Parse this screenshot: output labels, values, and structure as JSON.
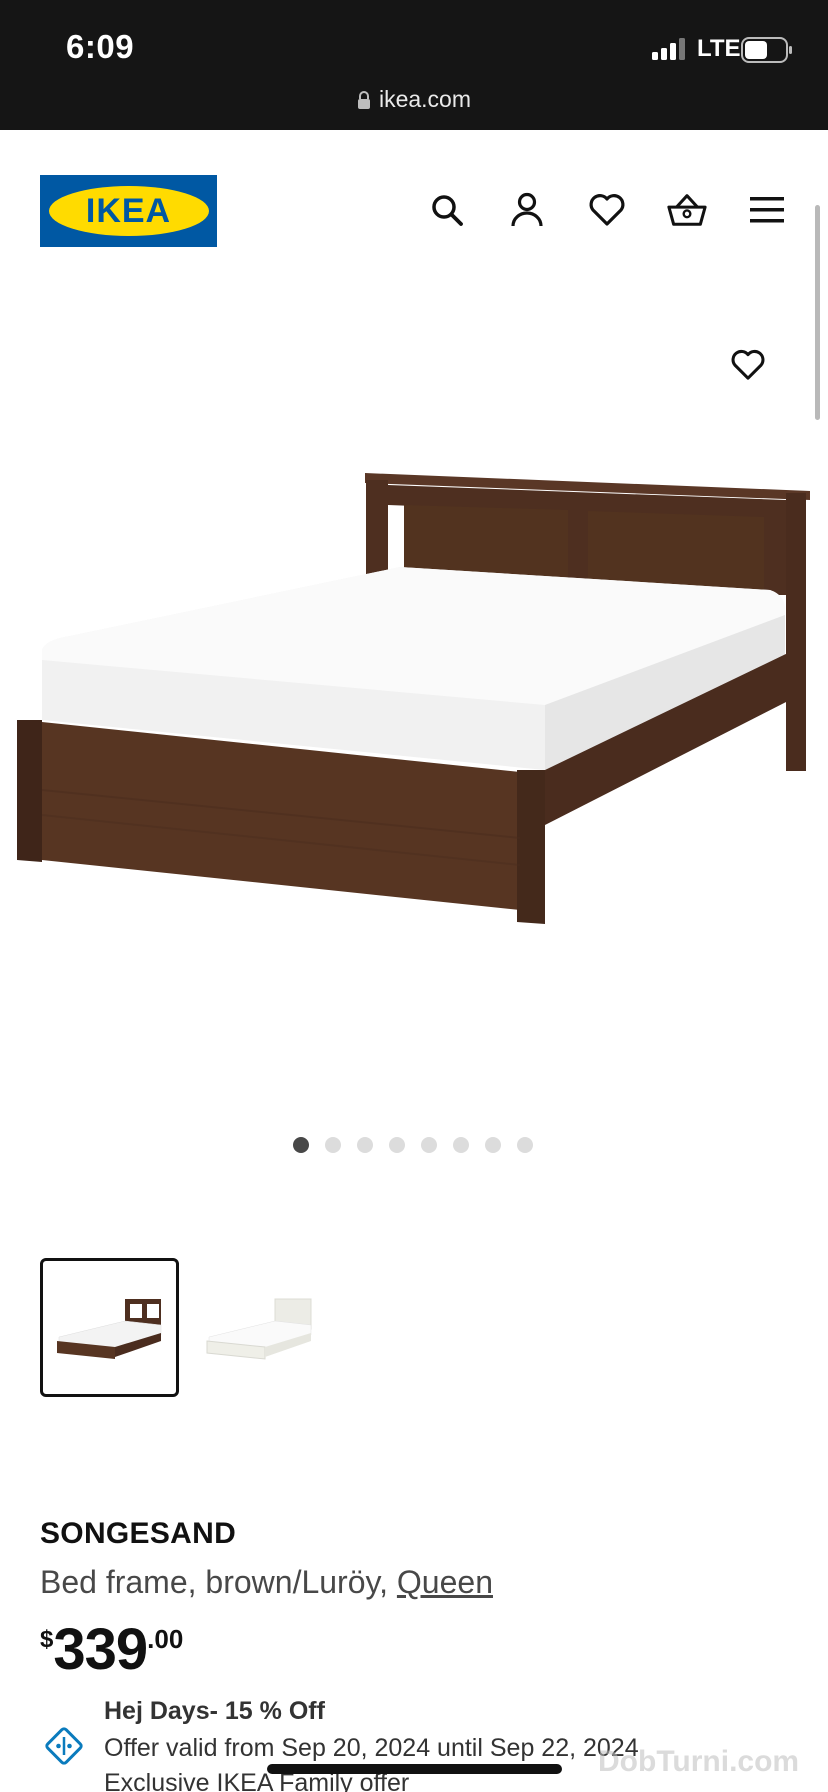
{
  "status_bar": {
    "time": "6:09",
    "network": "LTE",
    "url": "ikea.com"
  },
  "header": {
    "logo_text": "IKEA",
    "icons": [
      "search-icon",
      "account-icon",
      "heart-icon",
      "basket-icon",
      "menu-icon"
    ]
  },
  "gallery": {
    "total_images": 8,
    "active_index": 0,
    "thumbnails": [
      "brown",
      "white"
    ],
    "selected_thumbnail": 0
  },
  "product": {
    "name": "SONGESAND",
    "description_prefix": "Bed frame, brown/Luröy, ",
    "size_link": "Queen",
    "price_currency": "$",
    "price_integer": "339",
    "price_decimal": ".00"
  },
  "offer": {
    "title": "Hej Days- 15 % Off",
    "dates": "Offer valid from Sep 20, 2024 until Sep 22, 2024",
    "exclusive": "Exclusive IKEA Family offer"
  },
  "watermark": "DobTurni.com",
  "colors": {
    "ikea_blue": "#0058a3",
    "ikea_yellow": "#ffdb00",
    "wood_brown": "#4e2f20",
    "offer_icon": "#0a7bbd"
  }
}
